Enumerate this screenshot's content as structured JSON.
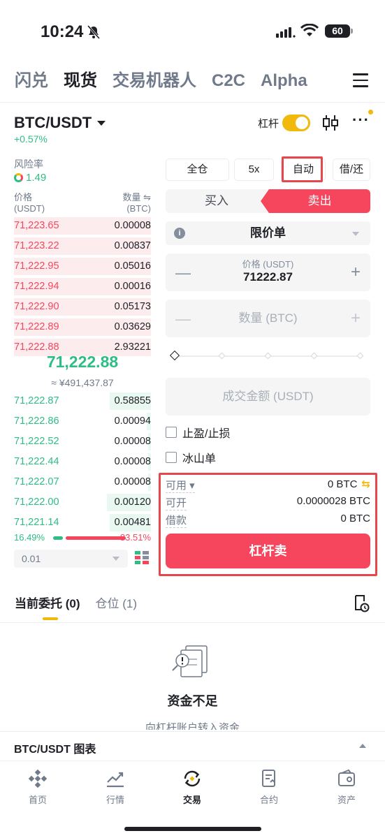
{
  "status_bar": {
    "time": "10:24",
    "battery": "60"
  },
  "top_tabs": [
    "闪兑",
    "现货",
    "交易机器人",
    "C2C",
    "Alpha"
  ],
  "active_top_tab": 1,
  "pair": {
    "symbol": "BTC/USDT",
    "change": "+0.57%",
    "leverage_label": "杠杆"
  },
  "risk": {
    "label": "风险率",
    "value": "1.49"
  },
  "orderbook": {
    "price_label": "价格",
    "price_unit": "(USDT)",
    "qty_label": "数量 ⇋",
    "qty_unit": "(BTC)",
    "asks": [
      {
        "price": "71,223.65",
        "qty": "0.00008",
        "depth": 1.0
      },
      {
        "price": "71,223.22",
        "qty": "0.00837",
        "depth": 1.0
      },
      {
        "price": "71,222.95",
        "qty": "0.05016",
        "depth": 1.0
      },
      {
        "price": "71,222.94",
        "qty": "0.00016",
        "depth": 1.0
      },
      {
        "price": "71,222.90",
        "qty": "0.05173",
        "depth": 1.0
      },
      {
        "price": "71,222.89",
        "qty": "0.03629",
        "depth": 1.0
      },
      {
        "price": "71,222.88",
        "qty": "2.93221",
        "depth": 1.0
      }
    ],
    "mid_price": "71,222.88",
    "mid_fiat": "≈ ¥491,437.87",
    "bids": [
      {
        "price": "71,222.87",
        "qty": "0.58855",
        "depth": 0.3
      },
      {
        "price": "71,222.86",
        "qty": "0.00094",
        "depth": 0.03
      },
      {
        "price": "71,222.52",
        "qty": "0.00008",
        "depth": 0.02
      },
      {
        "price": "71,222.44",
        "qty": "0.00008",
        "depth": 0.02
      },
      {
        "price": "71,222.07",
        "qty": "0.00008",
        "depth": 0.02
      },
      {
        "price": "71,222.00",
        "qty": "0.00120",
        "depth": 0.32
      },
      {
        "price": "71,221.14",
        "qty": "0.00481",
        "depth": 0.3
      }
    ],
    "buy_ratio": "16.49%",
    "sell_ratio": "83.51%",
    "precision": "0.01"
  },
  "trade": {
    "mode_buttons": [
      "全仓",
      "5x",
      "自动",
      "借/还"
    ],
    "buy_tab": "买入",
    "sell_tab": "卖出",
    "order_type": "限价单",
    "price_caption": "价格 (USDT)",
    "price_value": "71222.87",
    "qty_placeholder": "数量 (BTC)",
    "amount_placeholder": "成交金额 (USDT)",
    "tp_sl": "止盈/止损",
    "iceberg": "冰山单",
    "available_label": "可用",
    "available_value": "0 BTC",
    "openable_label": "可开",
    "openable_value": "0.0000028 BTC",
    "borrow_label": "借款",
    "borrow_value": "0 BTC",
    "submit": "杠杆卖"
  },
  "orders": {
    "tabs": [
      "当前委托 (0)",
      "仓位 (1)"
    ],
    "empty_title": "资金不足",
    "empty_sub": "向杠杆账户转入资金"
  },
  "chart_bar": {
    "title": "BTC/USDT 图表"
  },
  "bottom_nav": [
    "首页",
    "行情",
    "交易",
    "合约",
    "资产"
  ],
  "colors": {
    "accent": "#f0b90b",
    "sell": "#f6465d",
    "buy": "#2ebd85",
    "highlight": "#e5474c"
  }
}
